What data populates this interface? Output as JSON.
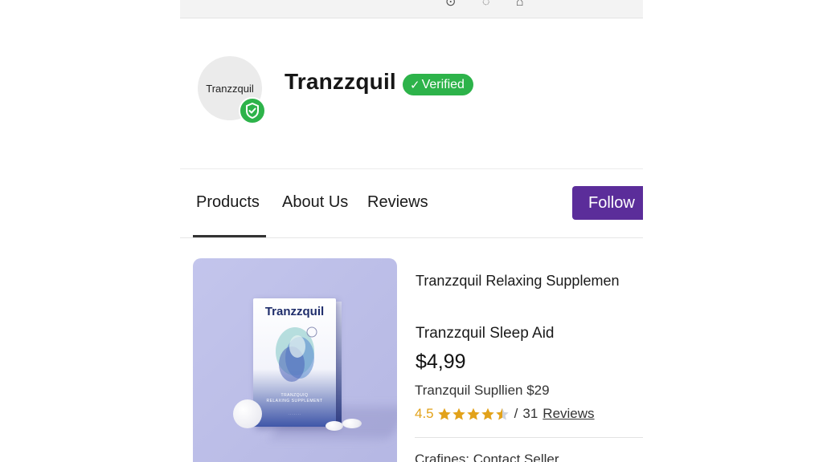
{
  "store": {
    "avatar_text": "Tranzzquil",
    "name": "Tranzzquil",
    "verified_label": "Verified"
  },
  "tabs": [
    {
      "label": "Products",
      "active": true
    },
    {
      "label": "About Us",
      "active": false
    },
    {
      "label": "Reviews",
      "active": false
    }
  ],
  "follow_label": "Follow",
  "product": {
    "image": {
      "package_brand": "Tranzzquil",
      "package_subtitle_1": "TRANZQUIQ",
      "package_subtitle_2": "RELAXING SUPPLEMENT"
    },
    "title": "Tranzzquil Relaxing Supplemen",
    "name": "Tranzzquil Sleep Aid",
    "price": "$4,99",
    "alt_price": "Tranzquil Supllien $29",
    "rating": {
      "value": "4.5",
      "stars": 4.5,
      "separator": "/",
      "count": "31",
      "link_label": "Reviews"
    },
    "seller_line": "Crafines: Contact Seller"
  },
  "colors": {
    "verified_green": "#2db34a",
    "follow_purple": "#5b2d9a",
    "star_gold": "#e2a21a",
    "product_bg": "#c3c5ec"
  },
  "icons": {
    "avatar_badge": "shield-check-icon",
    "verified": "checkmark-icon",
    "rating": "star-icon"
  }
}
